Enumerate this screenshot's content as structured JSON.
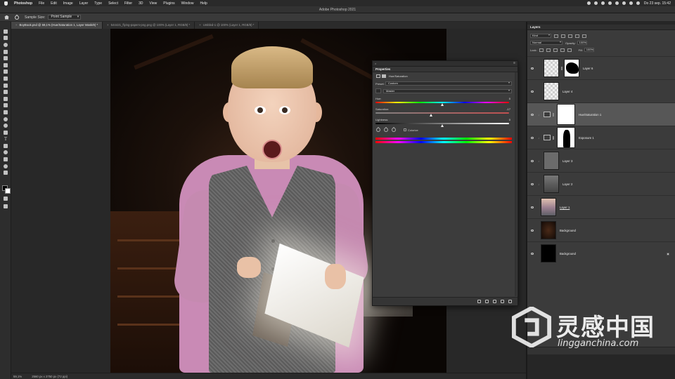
{
  "menubar": {
    "app": "Photoshop",
    "items": [
      "File",
      "Edit",
      "Image",
      "Layer",
      "Type",
      "Select",
      "Filter",
      "3D",
      "View",
      "Plugins",
      "Window",
      "Help"
    ],
    "clock": "Do 23 sep.  15:42"
  },
  "titlebar": {
    "title": "Adobe Photoshop 2021"
  },
  "optionsbar": {
    "sample_size_label": "Sample Size:",
    "sample_size_value": "Point Sample"
  },
  "doc_tabs": [
    {
      "label": "BoyBook.psd @ 59,1% (Hue/Saturation 1, Layer Mask/8) *"
    },
    {
      "label": "544421_flying-papers-png.png @ 100% (Layer 1, RGB/8) *"
    },
    {
      "label": "Untitled-1 @ 100% (Layer 1, RGB/8) *"
    }
  ],
  "properties": {
    "title": "Properties",
    "adjustment": "Hue/Saturation",
    "preset_label": "Preset:",
    "preset_value": "Custom",
    "channel_value": "Master",
    "hue_label": "Hue:",
    "hue_value": "0",
    "saturation_label": "Saturation:",
    "saturation_value": "-17",
    "lightness_label": "Lightness:",
    "lightness_value": "0",
    "colorize_label": "Colorize"
  },
  "layers_panel": {
    "title": "Layers",
    "filter_kind": "Kind",
    "blend_mode": "Normal",
    "opacity_label": "Opacity:",
    "opacity_value": "100%",
    "lock_label": "Lock:",
    "fill_label": "Fill:",
    "fill_value": "100%",
    "layers": [
      {
        "name": "Layer 6"
      },
      {
        "name": "Layer 4"
      },
      {
        "name": "Hue/Saturation 1",
        "selected": true
      },
      {
        "name": "Exposure 1"
      },
      {
        "name": "Layer 3"
      },
      {
        "name": "Layer 2"
      },
      {
        "name": "Layer 1"
      },
      {
        "name": "Background"
      },
      {
        "name": "Background"
      }
    ]
  },
  "status": {
    "zoom": "59,1%",
    "doc_size": "2560 px x 2750 px (72 ppi)"
  },
  "watermark": {
    "cn": "灵感中国",
    "en": "lingganchina.com"
  }
}
